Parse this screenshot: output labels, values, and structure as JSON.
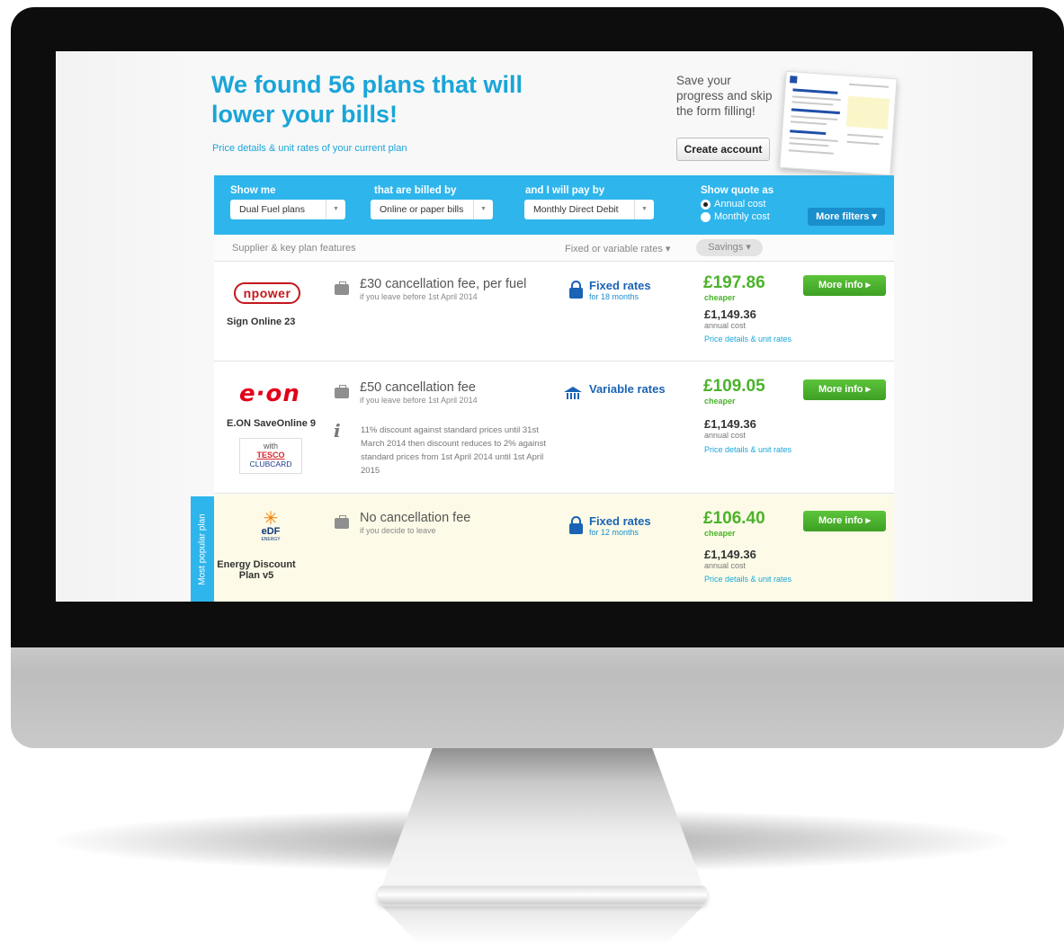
{
  "header": {
    "title": "We found 56 plans that will lower your bills!",
    "current_plan_link": "Price details & unit rates of your current plan"
  },
  "save_panel": {
    "text": "Save your progress and skip the form filling!",
    "button_label": "Create account"
  },
  "filters": {
    "show_me": {
      "label": "Show me",
      "value": "Dual Fuel plans"
    },
    "billed_by": {
      "label": "that are billed by",
      "value": "Online or paper bills"
    },
    "pay_by": {
      "label": "and I will pay by",
      "value": "Monthly Direct Debit"
    },
    "quote_as": {
      "label": "Show quote as",
      "options": [
        "Annual cost",
        "Monthly cost"
      ],
      "selected": "Annual cost"
    },
    "more_filters": "More filters ▾"
  },
  "columns": {
    "supplier": "Supplier & key plan features",
    "rates": "Fixed or variable rates ▾",
    "savings": "Savings ▾"
  },
  "plans": [
    {
      "supplier_logo": "npower",
      "name": "Sign Online 23",
      "fee": "£30 cancellation fee, per fuel",
      "fee_sub": "if you leave before 1st April 2014",
      "rate_type": "Fixed rates",
      "rate_sub": "for 18 months",
      "saving": "£197.86",
      "saving_label": "cheaper",
      "annual_cost": "£1,149.36",
      "annual_label": "annual cost",
      "details_link": "Price details & unit rates",
      "button": "More info ▸"
    },
    {
      "supplier_logo": "e·on",
      "name": "E.ON SaveOnline 9",
      "partner": {
        "with": "with",
        "brand": "TESCO",
        "sub": "CLUBCARD"
      },
      "fee": "£50 cancellation fee",
      "fee_sub": "if you leave before 1st April 2014",
      "discount": "11% discount against standard prices until 31st March 2014 then discount reduces to 2% against standard prices from 1st April 2014 until 1st April 2015",
      "rate_type": "Variable rates",
      "saving": "£109.05",
      "saving_label": "cheaper",
      "annual_cost": "£1,149.36",
      "annual_label": "annual cost",
      "details_link": "Price details & unit rates",
      "button": "More info ▸"
    },
    {
      "supplier_logo": "eDF",
      "supplier_logo_sub": "ENERGY",
      "name": "Energy Discount Plan v5",
      "fee": "No cancellation fee",
      "fee_sub": "if you decide to leave",
      "rate_type": "Fixed rates",
      "rate_sub": "for 12 months",
      "saving": "£106.40",
      "saving_label": "cheaper",
      "annual_cost": "£1,149.36",
      "annual_label": "annual cost",
      "details_link": "Price details & unit rates",
      "button": "More info ▸",
      "tag": "Most popular plan"
    }
  ],
  "colors": {
    "brand_blue": "#2eb5ec",
    "title_blue": "#1aa5d8",
    "rate_blue": "#1a63b5",
    "saving_green": "#4bb32b",
    "button_green": "#3e9f24",
    "popular_bg": "#fdfbe7"
  },
  "icons": [
    "briefcase-icon",
    "lock-icon",
    "house-icon",
    "info-icon",
    "edf-burst-icon"
  ]
}
